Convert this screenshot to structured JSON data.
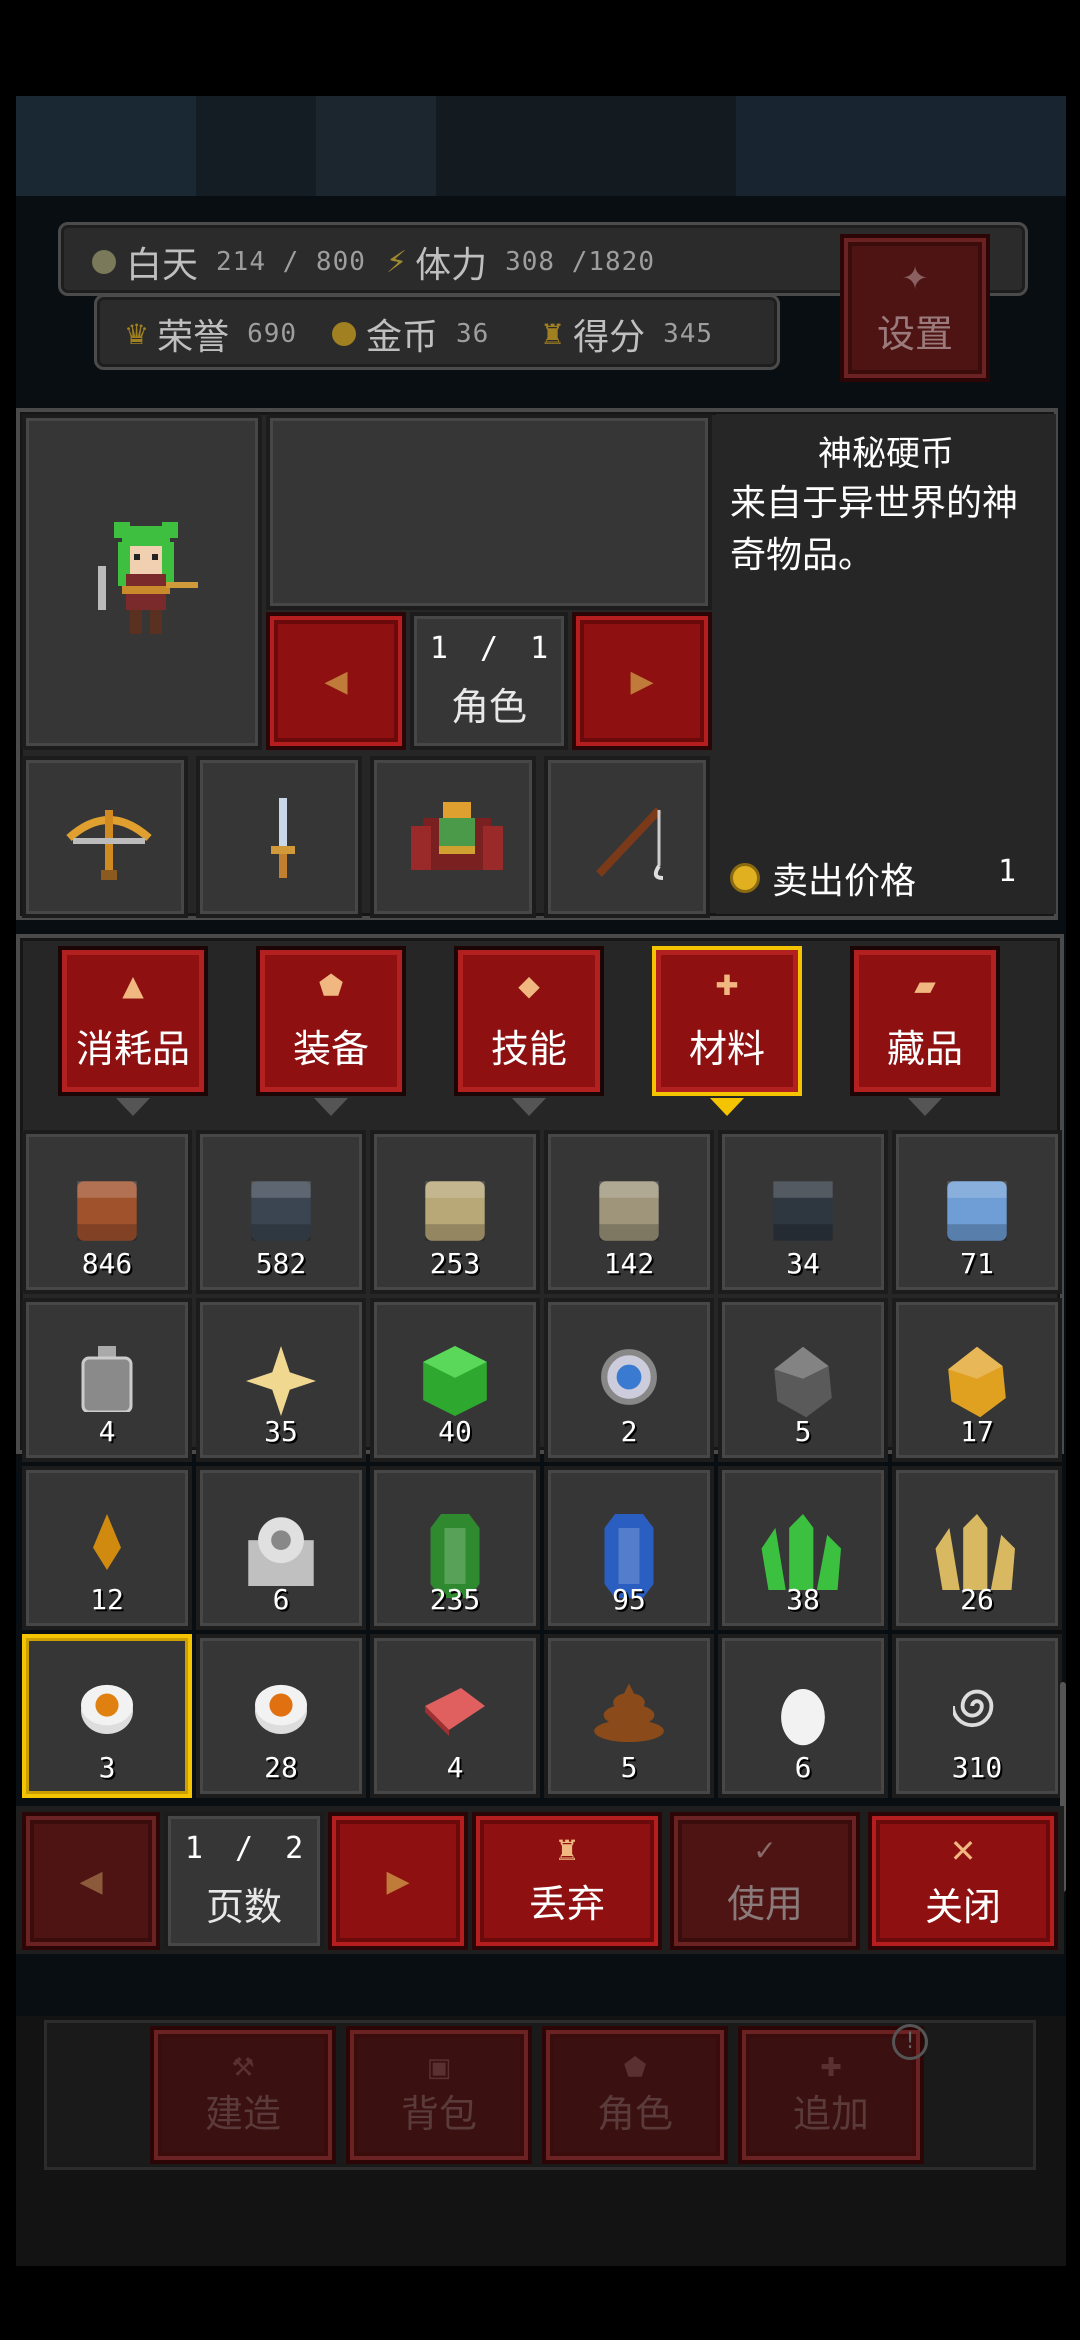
{
  "status": {
    "day_label": "白天",
    "day_value": "214 / 800",
    "stamina_label": "体力",
    "stamina_value": "308 /1820",
    "honor_label": "荣誉",
    "honor_value": "690",
    "gold_label": "金币",
    "gold_value": "36",
    "score_label": "得分",
    "score_value": "345",
    "settings_label": "设置"
  },
  "character": {
    "page_current": "1",
    "page_separator": "/",
    "page_total": "1",
    "page_label": "角色"
  },
  "equipment_slots": [
    {
      "icon": "crossbow-icon"
    },
    {
      "icon": "dagger-icon"
    },
    {
      "icon": "armor-icon"
    },
    {
      "icon": "fishing-rod-icon"
    }
  ],
  "detail": {
    "item_name": "神秘硬币",
    "description": "来自于异世界的神奇物品。",
    "price_label": "卖出价格",
    "price_value": "1"
  },
  "tabs": [
    {
      "label": "消耗品",
      "icon": "potion-icon",
      "selected": false
    },
    {
      "label": "装备",
      "icon": "shield-icon",
      "selected": false
    },
    {
      "label": "技能",
      "icon": "diamond-icon",
      "selected": false
    },
    {
      "label": "材料",
      "icon": "material-icon",
      "selected": true
    },
    {
      "label": "藏品",
      "icon": "collection-icon",
      "selected": false
    }
  ],
  "items": [
    {
      "icon": "brick-icon",
      "count": "846",
      "color": "#a0522d"
    },
    {
      "icon": "stone-block-icon",
      "count": "582",
      "color": "#3b4552"
    },
    {
      "icon": "sand-block-icon",
      "count": "253",
      "color": "#b8a878"
    },
    {
      "icon": "marble-block-icon",
      "count": "142",
      "color": "#9e957a"
    },
    {
      "icon": "slate-block-icon",
      "count": "34",
      "color": "#2e3640"
    },
    {
      "icon": "glass-block-icon",
      "count": "71",
      "color": "#6f9ed6"
    },
    {
      "icon": "metal-plate-icon",
      "count": "4",
      "color": "#8a8a8a"
    },
    {
      "icon": "star-icon",
      "count": "35",
      "color": "#f0d890"
    },
    {
      "icon": "green-cube-icon",
      "count": "40",
      "color": "#2ea82e"
    },
    {
      "icon": "gear-orb-icon",
      "count": "2",
      "color": "#9cc4e8"
    },
    {
      "icon": "coal-icon",
      "count": "5",
      "color": "#5a5a5a"
    },
    {
      "icon": "amber-icon",
      "count": "17",
      "color": "#e0a020"
    },
    {
      "icon": "flame-shard-icon",
      "count": "12",
      "color": "#d08a10"
    },
    {
      "icon": "silver-ore-icon",
      "count": "6",
      "color": "#c0c0c0"
    },
    {
      "icon": "emerald-icon",
      "count": "235",
      "color": "#2f8a2f"
    },
    {
      "icon": "sapphire-icon",
      "count": "95",
      "color": "#2a5ec0"
    },
    {
      "icon": "green-crystal-icon",
      "count": "38",
      "color": "#3cc040"
    },
    {
      "icon": "gold-crystal-icon",
      "count": "26",
      "color": "#d8b860"
    },
    {
      "icon": "coin-icon",
      "count": "3",
      "color": "#e08010",
      "selected": true
    },
    {
      "icon": "skull-coin-icon",
      "count": "28",
      "color": "#e07010"
    },
    {
      "icon": "meat-icon",
      "count": "4",
      "color": "#e06060"
    },
    {
      "icon": "dung-icon",
      "count": "5",
      "color": "#8a4a1a"
    },
    {
      "icon": "egg-icon",
      "count": "6",
      "color": "#f2f2f2"
    },
    {
      "icon": "spiral-icon",
      "count": "310",
      "color": "#dddddd"
    }
  ],
  "pager": {
    "page_current": "1",
    "page_separator": "/",
    "page_total": "2",
    "page_label": "页数"
  },
  "actions": {
    "discard_label": "丢弃",
    "use_label": "使用",
    "close_label": "关闭"
  },
  "bottom_nav": {
    "build_label": "建造",
    "bag_label": "背包",
    "role_label": "角色",
    "add_label": "追加"
  },
  "colors": {
    "accent_red": "#8e1010",
    "highlight_gold": "#f5c400",
    "panel": "#262626"
  }
}
